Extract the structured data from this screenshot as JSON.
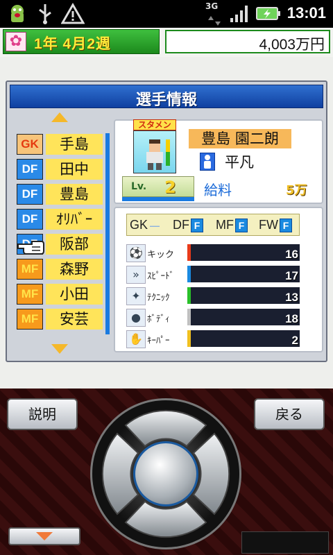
{
  "status_bar": {
    "network": "3G",
    "time": "13:01"
  },
  "header": {
    "date": "1年 4月2週",
    "money": "4,003万円"
  },
  "panel": {
    "title": "選手情報",
    "roster": [
      {
        "position": "GK",
        "name": "手島"
      },
      {
        "position": "DF",
        "name": "田中"
      },
      {
        "position": "DF",
        "name": "豊島"
      },
      {
        "position": "DF",
        "name": "ｵﾘﾊﾞｰ"
      },
      {
        "position": "DF",
        "name": "阪部"
      },
      {
        "position": "MF",
        "name": "森野"
      },
      {
        "position": "MF",
        "name": "小田"
      },
      {
        "position": "MF",
        "name": "安芸"
      }
    ],
    "player": {
      "badge": "スタメン",
      "full_name": "豊島 園二朗",
      "personality": "平凡",
      "level_label": "Lv.",
      "level": "2",
      "salary_label": "給料",
      "salary": "5万"
    },
    "aptitudes": [
      {
        "pos": "GK",
        "grade": "—"
      },
      {
        "pos": "DF",
        "grade": "F"
      },
      {
        "pos": "MF",
        "grade": "F"
      },
      {
        "pos": "FW",
        "grade": "F"
      }
    ],
    "stats": [
      {
        "label": "キック",
        "value": "16",
        "color": "#e83a1a"
      },
      {
        "label": "ｽﾋﾟｰﾄﾞ",
        "value": "17",
        "color": "#1a8ae0"
      },
      {
        "label": "ﾃｸﾆｯｸ",
        "value": "13",
        "color": "#2ac02a"
      },
      {
        "label": "ﾎﾞﾃﾞｨ",
        "value": "18",
        "color": "#c0c0c0"
      },
      {
        "label": "ｷｰﾊﾟｰ",
        "value": "2",
        "color": "#f0c020"
      }
    ]
  },
  "controller": {
    "left_button": "説明",
    "right_button": "戻る"
  }
}
